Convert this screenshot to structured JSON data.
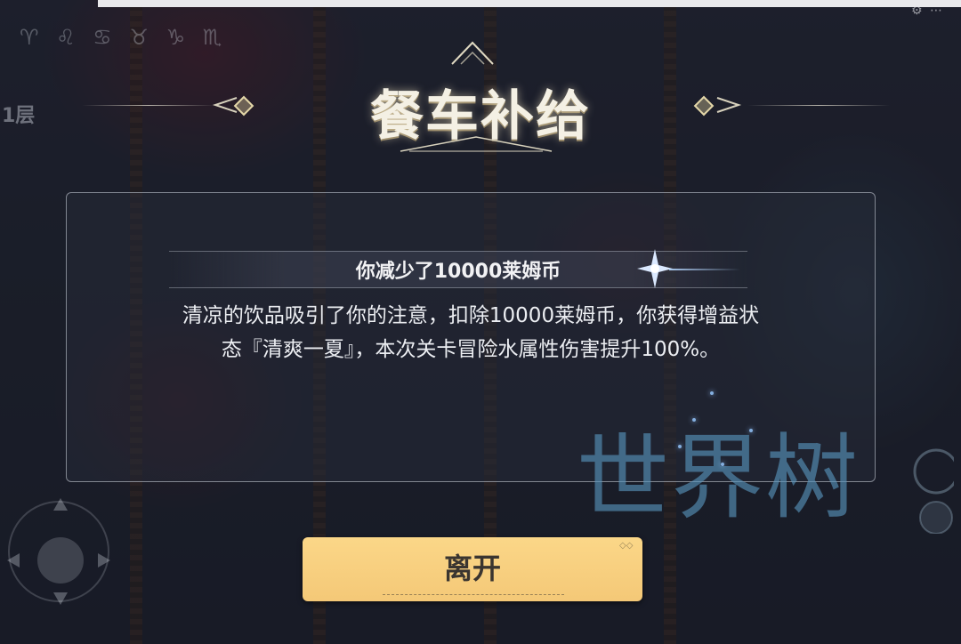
{
  "hud": {
    "zodiac_glyphs": "♈ ♌ ♋ ♉ ♑ ♏",
    "floor_label": "1层",
    "top_right_icons": "⚙ ⋯"
  },
  "dialog": {
    "title": "餐车补给",
    "heading": "你减少了10000莱姆币",
    "body_line_1": "清凉的饮品吸引了你的注意，扣除10000莱姆币，你获得增益状",
    "body_line_2": "态『清爽一夏』，本次关卡冒险水属性伤害提升100%。"
  },
  "leave_button": {
    "label": "离开"
  },
  "watermark": {
    "text": "世界树"
  },
  "colors": {
    "button": "#f4c877",
    "title": "#f4f0e4",
    "watermark": "#5896be"
  },
  "icons": [
    "diamond-icon",
    "sparkle-icon",
    "joystick-icon",
    "skill-icon"
  ]
}
